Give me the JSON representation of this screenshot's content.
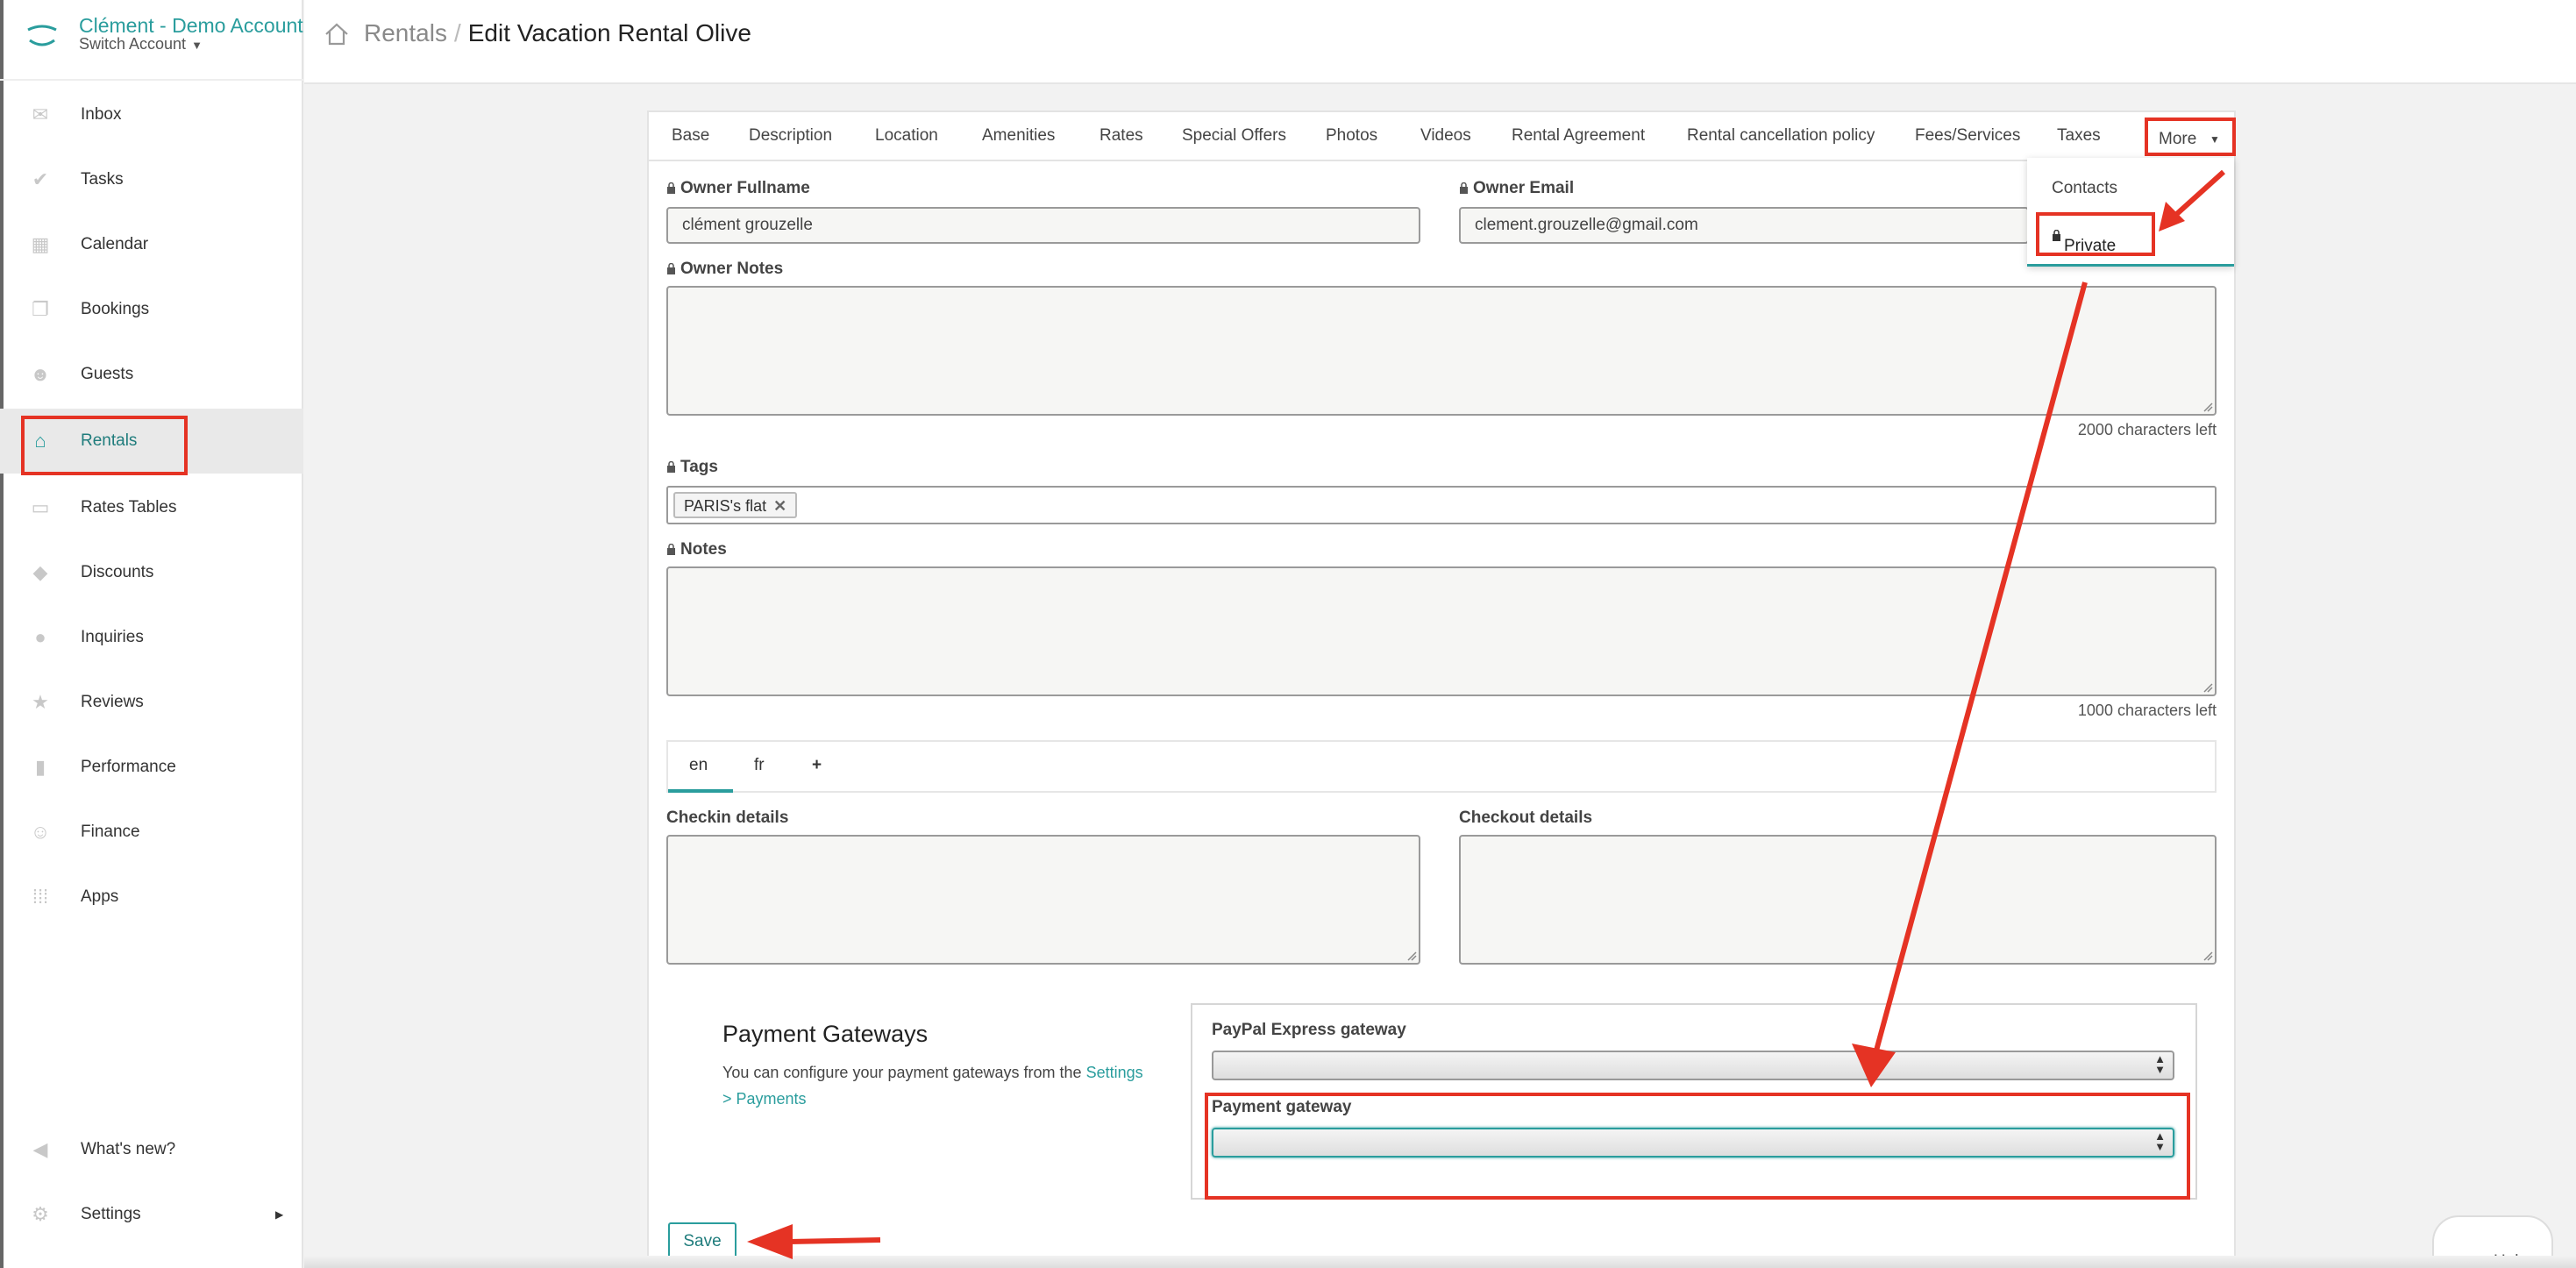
{
  "account": {
    "name": "Clément - Demo Account",
    "switch_label": "Switch Account"
  },
  "nav": {
    "items": [
      {
        "label": "Inbox",
        "icon": "inbox-icon"
      },
      {
        "label": "Tasks",
        "icon": "check-icon"
      },
      {
        "label": "Calendar",
        "icon": "calendar-icon"
      },
      {
        "label": "Bookings",
        "icon": "book-icon"
      },
      {
        "label": "Guests",
        "icon": "users-icon"
      },
      {
        "label": "Rentals",
        "icon": "home-icon"
      },
      {
        "label": "Rates Tables",
        "icon": "money-icon"
      },
      {
        "label": "Discounts",
        "icon": "tag-icon"
      },
      {
        "label": "Inquiries",
        "icon": "chat-icon"
      },
      {
        "label": "Reviews",
        "icon": "star-icon"
      },
      {
        "label": "Performance",
        "icon": "bar-chart-icon"
      },
      {
        "label": "Finance",
        "icon": "hand-coin-icon"
      },
      {
        "label": "Apps",
        "icon": "grid-icon"
      },
      {
        "label": "What's new?",
        "icon": "megaphone-icon"
      },
      {
        "label": "Settings",
        "icon": "gear-icon"
      }
    ],
    "active": "Rentals"
  },
  "header": {
    "crumb_root": "Rentals",
    "separator": "/",
    "title": "Edit Vacation Rental Olive"
  },
  "tabs": {
    "items": [
      "Base",
      "Description",
      "Location",
      "Amenities",
      "Rates",
      "Special Offers",
      "Photos",
      "Videos",
      "Rental Agreement",
      "Rental cancellation policy",
      "Fees/Services",
      "Taxes"
    ],
    "more_label": "More"
  },
  "dropdown": {
    "items": [
      "Contacts",
      "Private"
    ]
  },
  "form": {
    "owner_fullname_label": "Owner Fullname",
    "owner_fullname_value": "clément grouzelle",
    "owner_email_label": "Owner Email",
    "owner_email_value": "clement.grouzelle@gmail.com",
    "owner_notes_label": "Owner Notes",
    "owner_notes_hint": "2000 characters left",
    "tags_label": "Tags",
    "tags": [
      "PARIS's flat"
    ],
    "notes_label": "Notes",
    "notes_hint": "1000 characters left",
    "languages": [
      "en",
      "fr",
      "+"
    ],
    "checkin_label": "Checkin details",
    "checkout_label": "Checkout details"
  },
  "payment": {
    "title": "Payment Gateways",
    "desc_prefix": "You can configure your payment gateways from the ",
    "desc_link_a": "Settings",
    "desc_link_b": "> Payments",
    "paypal_label": "PayPal Express gateway",
    "gateway_label": "Payment gateway"
  },
  "save_label": "Save",
  "help_label": "Help",
  "colors": {
    "accent": "#2a9d9d",
    "annotation": "#e53324"
  }
}
